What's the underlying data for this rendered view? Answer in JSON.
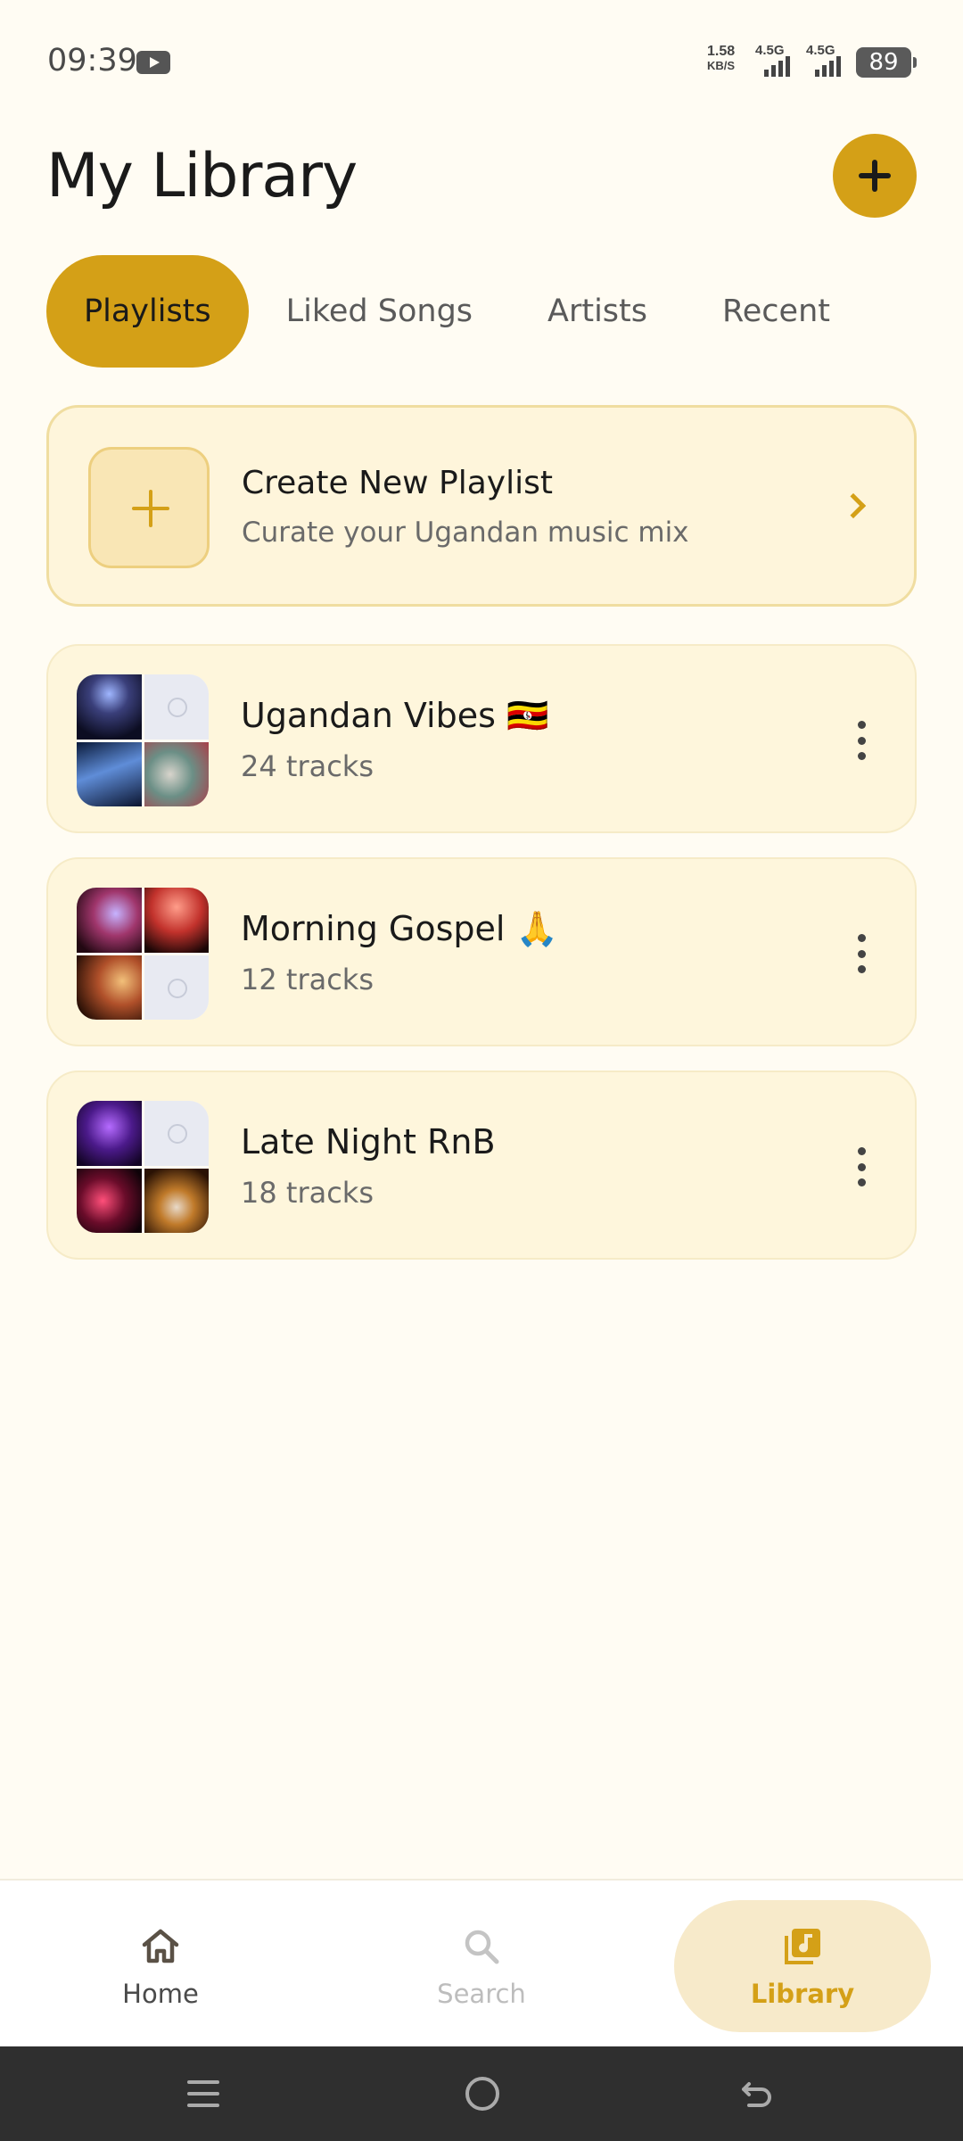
{
  "status_bar": {
    "time": "09:39",
    "net_speed_value": "1.58",
    "net_speed_unit": "KB/S",
    "signal1": "4.5G",
    "signal2": "4.5G",
    "battery": "89"
  },
  "header": {
    "title": "My Library",
    "add_icon": "plus-icon"
  },
  "tabs": [
    {
      "label": "Playlists",
      "active": true
    },
    {
      "label": "Liked Songs",
      "active": false
    },
    {
      "label": "Artists",
      "active": false
    },
    {
      "label": "Recent",
      "active": false
    }
  ],
  "create_card": {
    "title": "Create New Playlist",
    "subtitle": "Curate your Ugandan music mix"
  },
  "playlists": [
    {
      "title": "Ugandan Vibes 🇺🇬",
      "tracks": "24 tracks"
    },
    {
      "title": "Morning Gospel 🙏",
      "tracks": "12 tracks"
    },
    {
      "title": "Late Night RnB",
      "tracks": "18 tracks"
    }
  ],
  "bottom_nav": [
    {
      "label": "Home",
      "icon": "home-icon",
      "active": false
    },
    {
      "label": "Search",
      "icon": "search-icon",
      "active": false
    },
    {
      "label": "Library",
      "icon": "library-music-icon",
      "active": true
    }
  ],
  "colors": {
    "accent": "#D4A017",
    "background": "#FFFCF3",
    "card": "#FEF6DC",
    "active_nav_bg": "#F7EACA"
  }
}
